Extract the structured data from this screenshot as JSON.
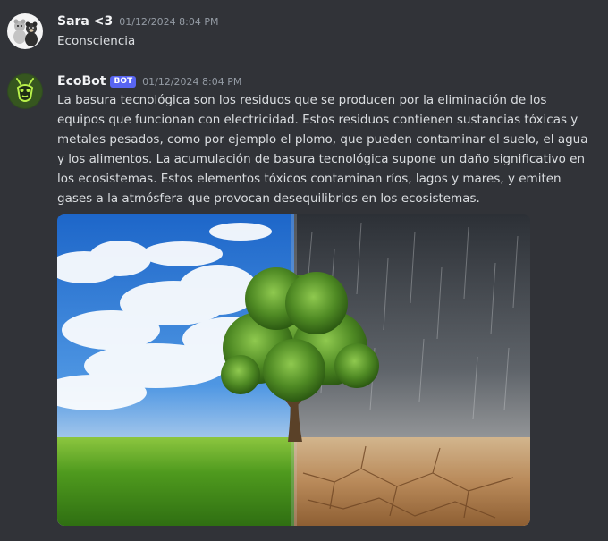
{
  "messages": [
    {
      "username": "Sara <3",
      "timestamp": "01/12/2024 8:04 PM",
      "text": "Econsciencia",
      "avatar_icon": "plush-toys-avatar"
    },
    {
      "username": "EcoBot",
      "badge": "BOT",
      "timestamp": "01/12/2024 8:04 PM",
      "lines": [
        "La basura tecnológica son los residuos que se producen por la eliminación de los",
        "equipos que funcionan con electricidad. Estos residuos contienen sustancias tóxicas y",
        "metales pesados, como por ejemplo el plomo, que pueden contaminar el suelo, el agua",
        "y los alimentos. La acumulación de basura tecnológica supone un daño significativo en",
        "los ecosistemas. Estos elementos tóxicos contaminan ríos, lagos y mares, y emiten",
        "gases a la atmósfera que provocan desequilibrios en los ecosistemas."
      ],
      "avatar_icon": "green-bug-avatar",
      "attachment_icon": "tree-healthy-vs-drought-image"
    }
  ],
  "colors": {
    "background": "#313338",
    "username": "#f2f3f5",
    "text": "#dbdee1",
    "timestamp": "#949ba4",
    "bot_badge": "#5865f2"
  }
}
